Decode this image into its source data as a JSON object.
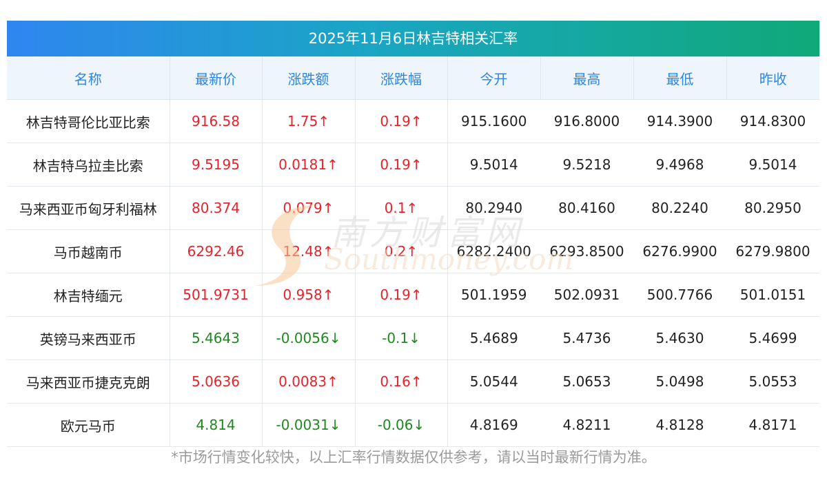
{
  "title": "2025年11月6日林吉特相关汇率",
  "headers": [
    "名称",
    "最新价",
    "涨跌额",
    "涨跌幅",
    "今开",
    "最高",
    "最低",
    "昨收"
  ],
  "rows": [
    {
      "name": "林吉特哥伦比亚比索",
      "latest": "916.58",
      "change": "1.75↑",
      "pct": "0.19↑",
      "open": "915.1600",
      "high": "916.8000",
      "low": "914.3900",
      "prev": "914.8300",
      "dir": "up"
    },
    {
      "name": "林吉特乌拉圭比索",
      "latest": "9.5195",
      "change": "0.0181↑",
      "pct": "0.19↑",
      "open": "9.5014",
      "high": "9.5218",
      "low": "9.4968",
      "prev": "9.5014",
      "dir": "up"
    },
    {
      "name": "马来西亚币匈牙利福林",
      "latest": "80.374",
      "change": "0.079↑",
      "pct": "0.1↑",
      "open": "80.2940",
      "high": "80.4160",
      "low": "80.2240",
      "prev": "80.2950",
      "dir": "up"
    },
    {
      "name": "马币越南币",
      "latest": "6292.46",
      "change": "12.48↑",
      "pct": "0.2↑",
      "open": "6282.2400",
      "high": "6293.8500",
      "low": "6276.9900",
      "prev": "6279.9800",
      "dir": "up"
    },
    {
      "name": "林吉特缅元",
      "latest": "501.9731",
      "change": "0.958↑",
      "pct": "0.19↑",
      "open": "501.1959",
      "high": "502.0931",
      "low": "500.7766",
      "prev": "501.0151",
      "dir": "up"
    },
    {
      "name": "英镑马来西亚币",
      "latest": "5.4643",
      "change": "-0.0056↓",
      "pct": "-0.1↓",
      "open": "5.4689",
      "high": "5.4736",
      "low": "5.4630",
      "prev": "5.4699",
      "dir": "down"
    },
    {
      "name": "马来西亚币捷克克朗",
      "latest": "5.0636",
      "change": "0.0083↑",
      "pct": "0.16↑",
      "open": "5.0544",
      "high": "5.0653",
      "low": "5.0498",
      "prev": "5.0553",
      "dir": "up"
    },
    {
      "name": "欧元马币",
      "latest": "4.814",
      "change": "-0.0031↓",
      "pct": "-0.06↓",
      "open": "4.8169",
      "high": "4.8211",
      "low": "4.8128",
      "prev": "4.8171",
      "dir": "down"
    }
  ],
  "colors": {
    "up": "#e8222a",
    "down": "#1d8a1d",
    "header_text": "#2f86e0"
  },
  "watermark": {
    "cn": "南方财富网",
    "en": "Southmoney.com"
  },
  "footnote": "*市场行情变化较快，以上汇率行情数据仅供参考，请以当时最新行情为准。"
}
